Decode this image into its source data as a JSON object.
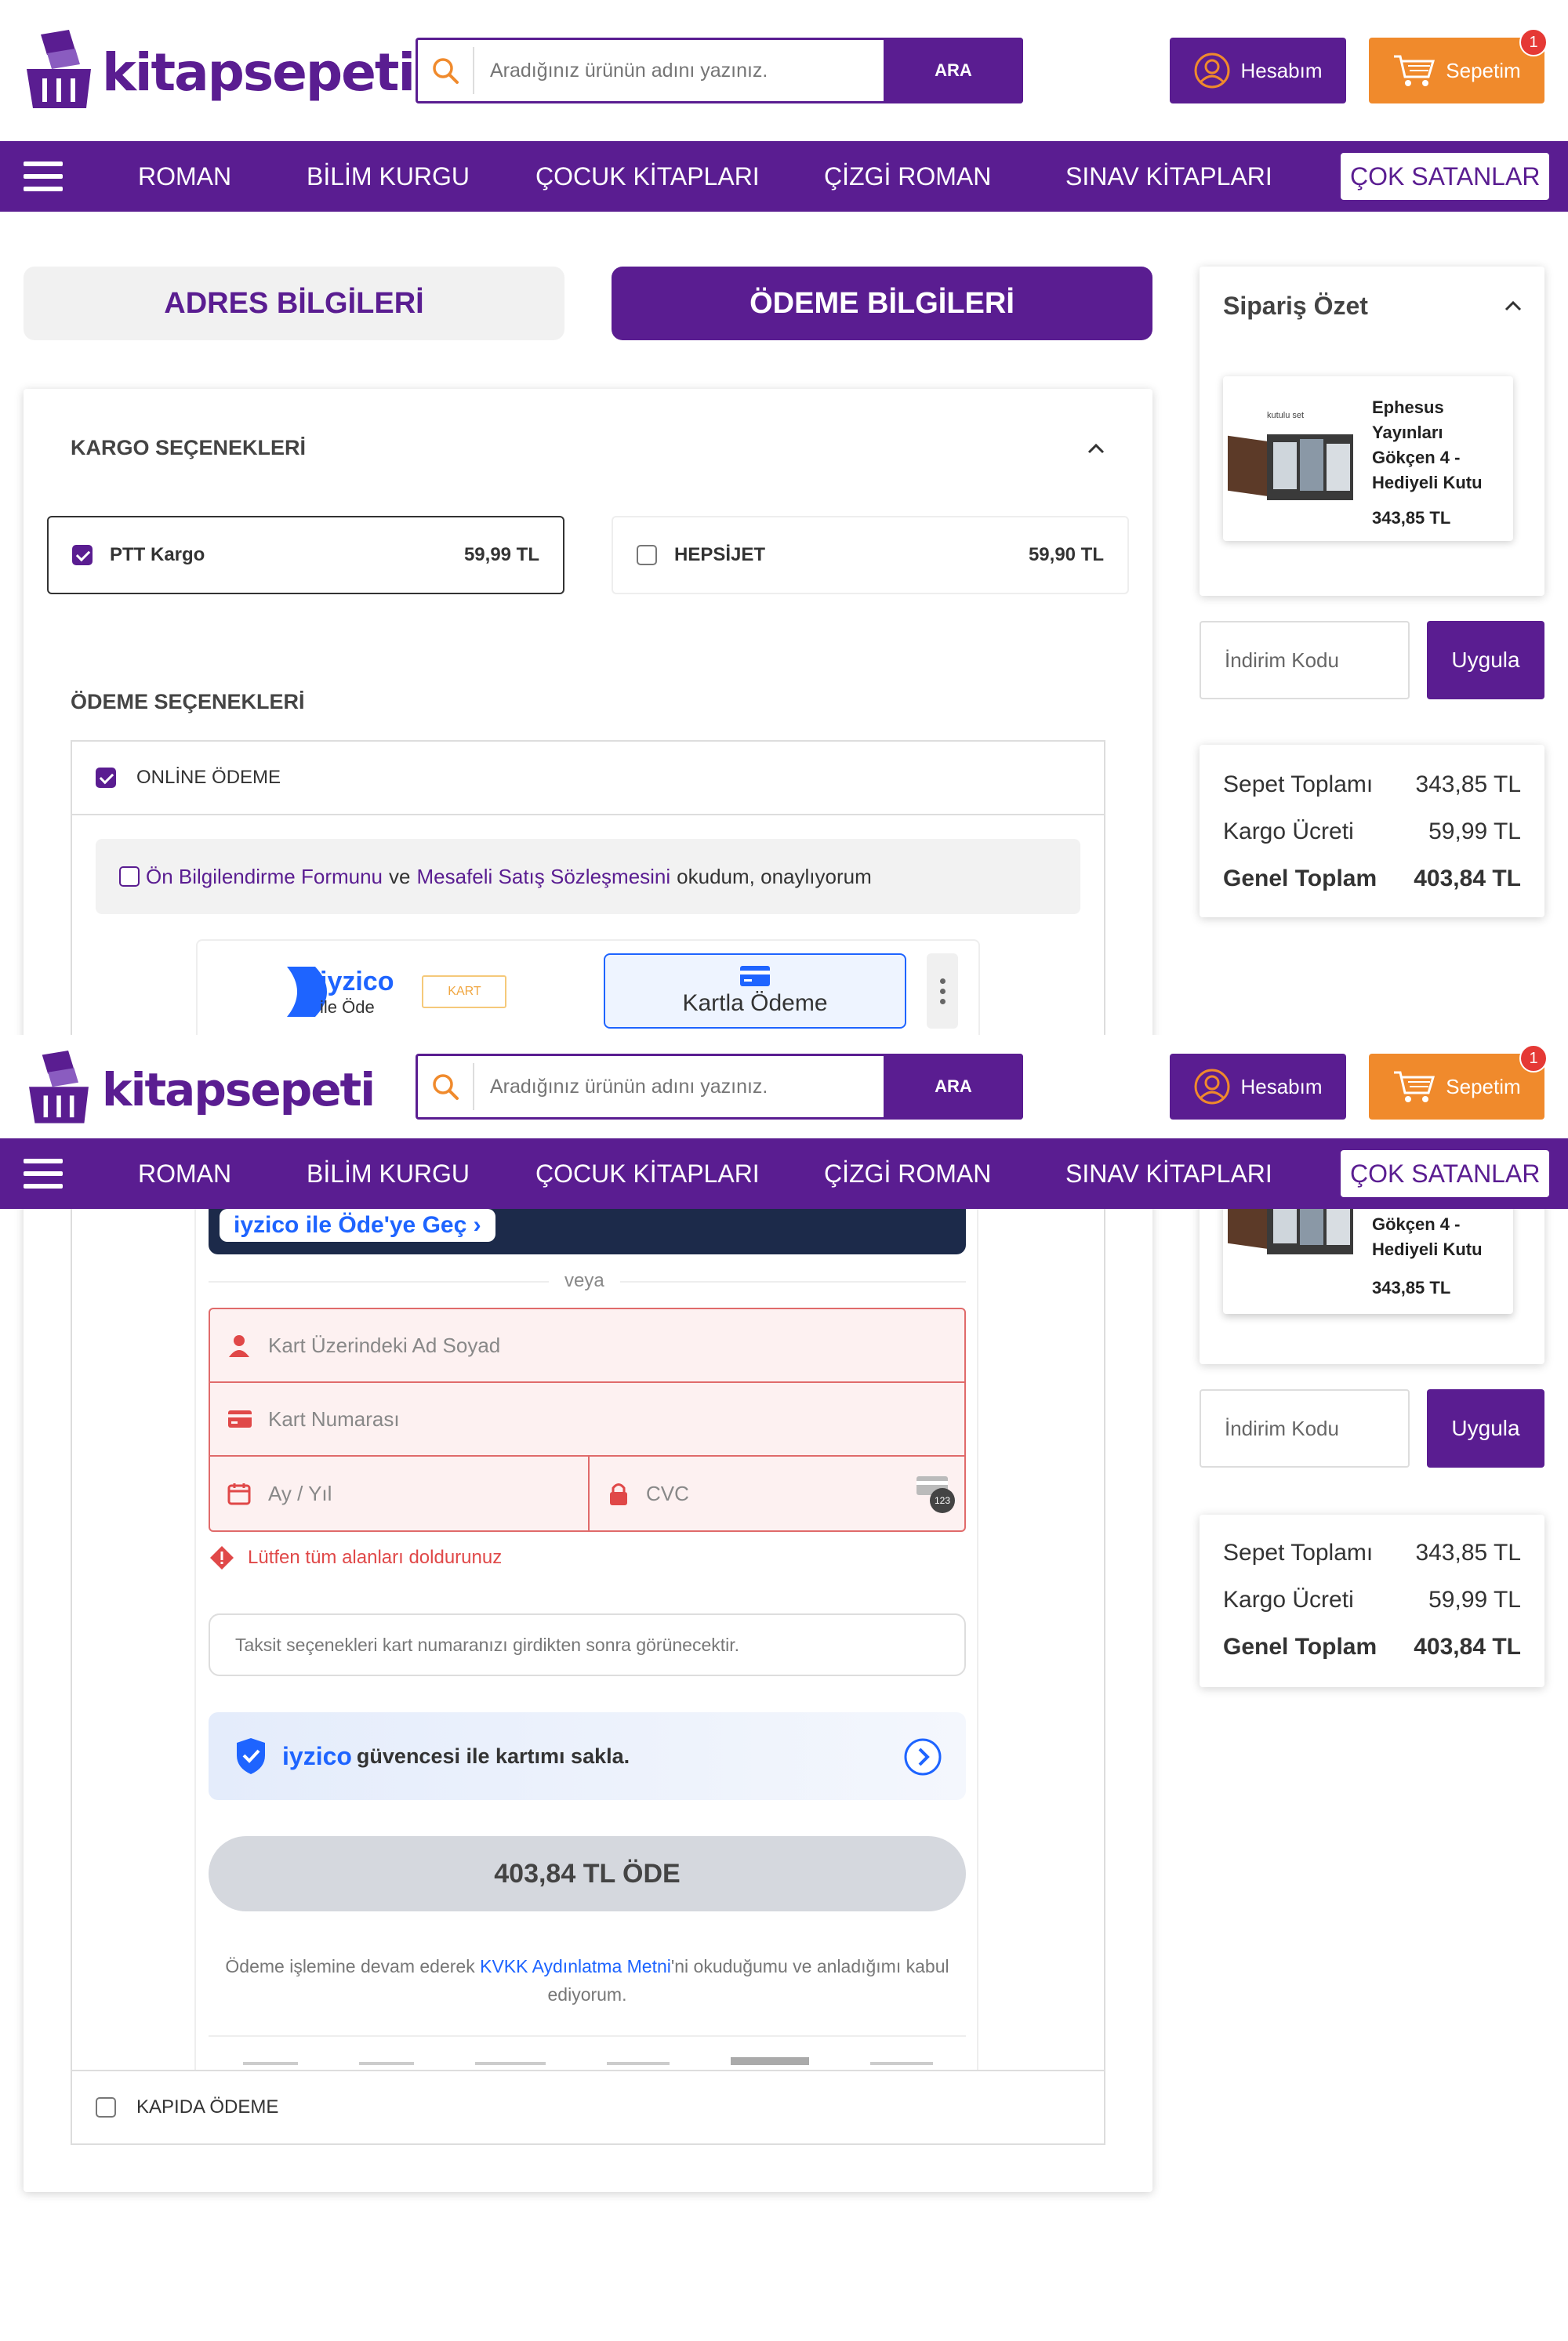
{
  "header": {
    "logo_text": "kitapsepeti",
    "search_placeholder": "Aradığınız ürünün adını yazınız.",
    "search_button": "ARA",
    "account_label": "Hesabım",
    "cart_label": "Sepetim",
    "cart_count": "1"
  },
  "nav": {
    "items": [
      "ROMAN",
      "BİLİM KURGU",
      "ÇOCUK KİTAPLARI",
      "ÇİZGİ ROMAN",
      "SINAV KİTAPLARI",
      "ÇOK SATANLAR"
    ]
  },
  "steps": {
    "address": "ADRES BİLGİLERİ",
    "payment": "ÖDEME BİLGİLERİ"
  },
  "shipping": {
    "title": "KARGO SEÇENEKLERİ",
    "options": [
      {
        "name": "PTT Kargo",
        "price": "59,99 TL",
        "selected": true
      },
      {
        "name": "HEPSİJET",
        "price": "59,90 TL",
        "selected": false
      }
    ]
  },
  "payment": {
    "title": "ÖDEME SEÇENEKLERİ",
    "online_label": "ONLİNE ÖDEME",
    "consent": {
      "link1": "Ön Bilgilendirme Formunu",
      "and": "ve",
      "link2": "Mesafeli Satış Sözleşmesini",
      "rest": "okudum, onaylıyorum"
    },
    "cod_label": "KAPIDA ÖDEME"
  },
  "iyzico": {
    "brand": "iyzico",
    "pay_with": "ile Öde",
    "kart_tag": "KART",
    "card_tab": "Kartla Ödeme",
    "switch_button": "iyzico ile Öde'ye Geç ›",
    "or_label": "veya",
    "name_placeholder": "Kart Üzerindeki Ad Soyad",
    "number_placeholder": "Kart Numarası",
    "expiry_placeholder": "Ay / Yıl",
    "cvc_placeholder": "CVC",
    "cvc_badge": "123",
    "error": "Lütfen tüm alanları doldurunuz",
    "installment_note": "Taksit seçenekleri kart numaranızı girdikten sonra görünecektir.",
    "save_card_brand": "iyzico",
    "save_card_text": "güvencesi ile kartımı sakla.",
    "pay_button": "403,84 TL ÖDE",
    "kvkk_pre": "Ödeme işlemine devam ederek",
    "kvkk_link": "KVKK Aydınlatma Metni",
    "kvkk_post": "'ni okuduğumu ve anladığımı kabul ediyorum."
  },
  "summary": {
    "title": "Sipariş Özet",
    "product_name": "Ephesus Yayınları Gökçen 4 - Hediyeli Kutu",
    "product_name_partial": "Gökçen 4 - Hediyeli Kutu",
    "product_price": "343,85 TL",
    "product_img_caption": "kutulu set",
    "discount_placeholder": "İndirim Kodu",
    "apply_button": "Uygula",
    "rows": [
      {
        "label": "Sepet Toplamı",
        "value": "343,85 TL"
      },
      {
        "label": "Kargo Ücreti",
        "value": "59,99 TL"
      },
      {
        "label": "Genel Toplam",
        "value": "403,84 TL"
      }
    ]
  },
  "colors": {
    "brand_purple": "#5a1d91",
    "cart_orange": "#f08a2c",
    "error_red": "#e04848",
    "iyzico_blue": "#1e64ff"
  }
}
